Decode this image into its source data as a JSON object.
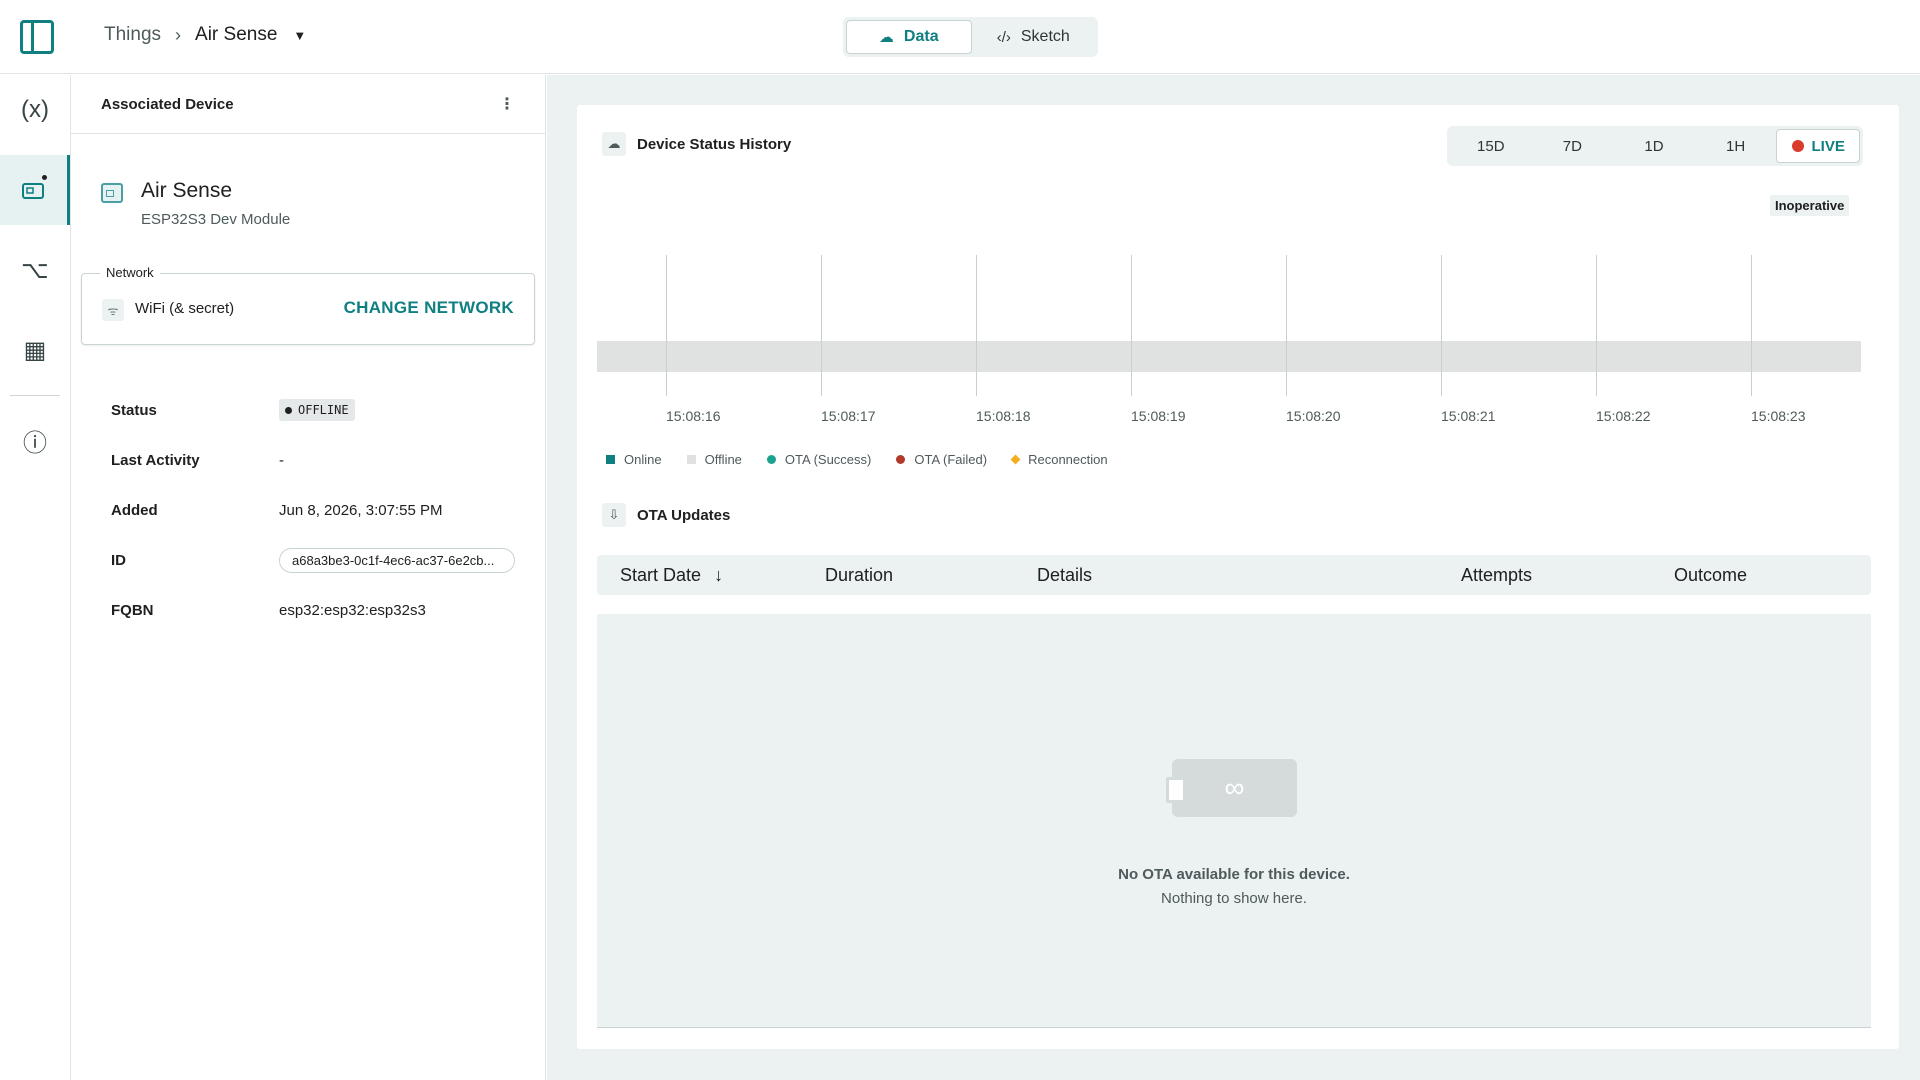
{
  "header": {
    "breadcrumb_root": "Things",
    "breadcrumb_current": "Air Sense",
    "tabs": [
      {
        "label": "Data",
        "icon": "cloud-data-icon",
        "active": true
      },
      {
        "label": "Sketch",
        "icon": "code-icon",
        "active": false
      }
    ]
  },
  "rail": {
    "items": [
      {
        "icon": "variables-icon",
        "active": false
      },
      {
        "icon": "device-icon",
        "active": true
      },
      {
        "icon": "webhooks-icon",
        "active": false
      },
      {
        "icon": "dashboard-link-icon",
        "active": false
      },
      {
        "icon": "info-icon",
        "active": false
      }
    ]
  },
  "panel": {
    "title": "Associated Device",
    "device_name": "Air Sense",
    "device_type": "ESP32S3 Dev Module",
    "network_legend": "Network",
    "network_name": "WiFi (& secret)",
    "change_network": "CHANGE NETWORK",
    "props": {
      "status_label": "Status",
      "status_value": "OFFLINE",
      "activity_label": "Last Activity",
      "activity_value": "-",
      "added_label": "Added",
      "added_value": "Jun 8, 2026, 3:07:55 PM",
      "id_label": "ID",
      "id_value": "a68a3be3-0c1f-4ec6-ac37-6e2cb...",
      "fqbn_label": "FQBN",
      "fqbn_value": "esp32:esp32:esp32s3"
    }
  },
  "status_history": {
    "title": "Device Status History",
    "ranges": [
      "15D",
      "7D",
      "1D",
      "1H"
    ],
    "live_label": "LIVE",
    "state_tag": "Inoperative",
    "ticks": [
      "15:08:16",
      "15:08:17",
      "15:08:18",
      "15:08:19",
      "15:08:20",
      "15:08:21",
      "15:08:22",
      "15:08:23"
    ],
    "legend": [
      {
        "label": "Online",
        "color": "#0f7f82",
        "shape": "square"
      },
      {
        "label": "Offline",
        "color": "#e0e2e2",
        "shape": "square"
      },
      {
        "label": "OTA (Success)",
        "color": "#1aa38e",
        "shape": "round"
      },
      {
        "label": "OTA (Failed)",
        "color": "#b33a2a",
        "shape": "round"
      },
      {
        "label": "Reconnection",
        "color": "#f2b01e",
        "shape": "diamond"
      }
    ]
  },
  "ota": {
    "title": "OTA Updates",
    "columns": {
      "start_date": "Start Date",
      "duration": "Duration",
      "details": "Details",
      "attempts": "Attempts",
      "outcome": "Outcome"
    },
    "empty_title": "No OTA available for this device.",
    "empty_sub": "Nothing to show here."
  },
  "colors": {
    "accent": "#0f7f82",
    "live": "#da3b2c",
    "background": "#ecf1f1"
  }
}
